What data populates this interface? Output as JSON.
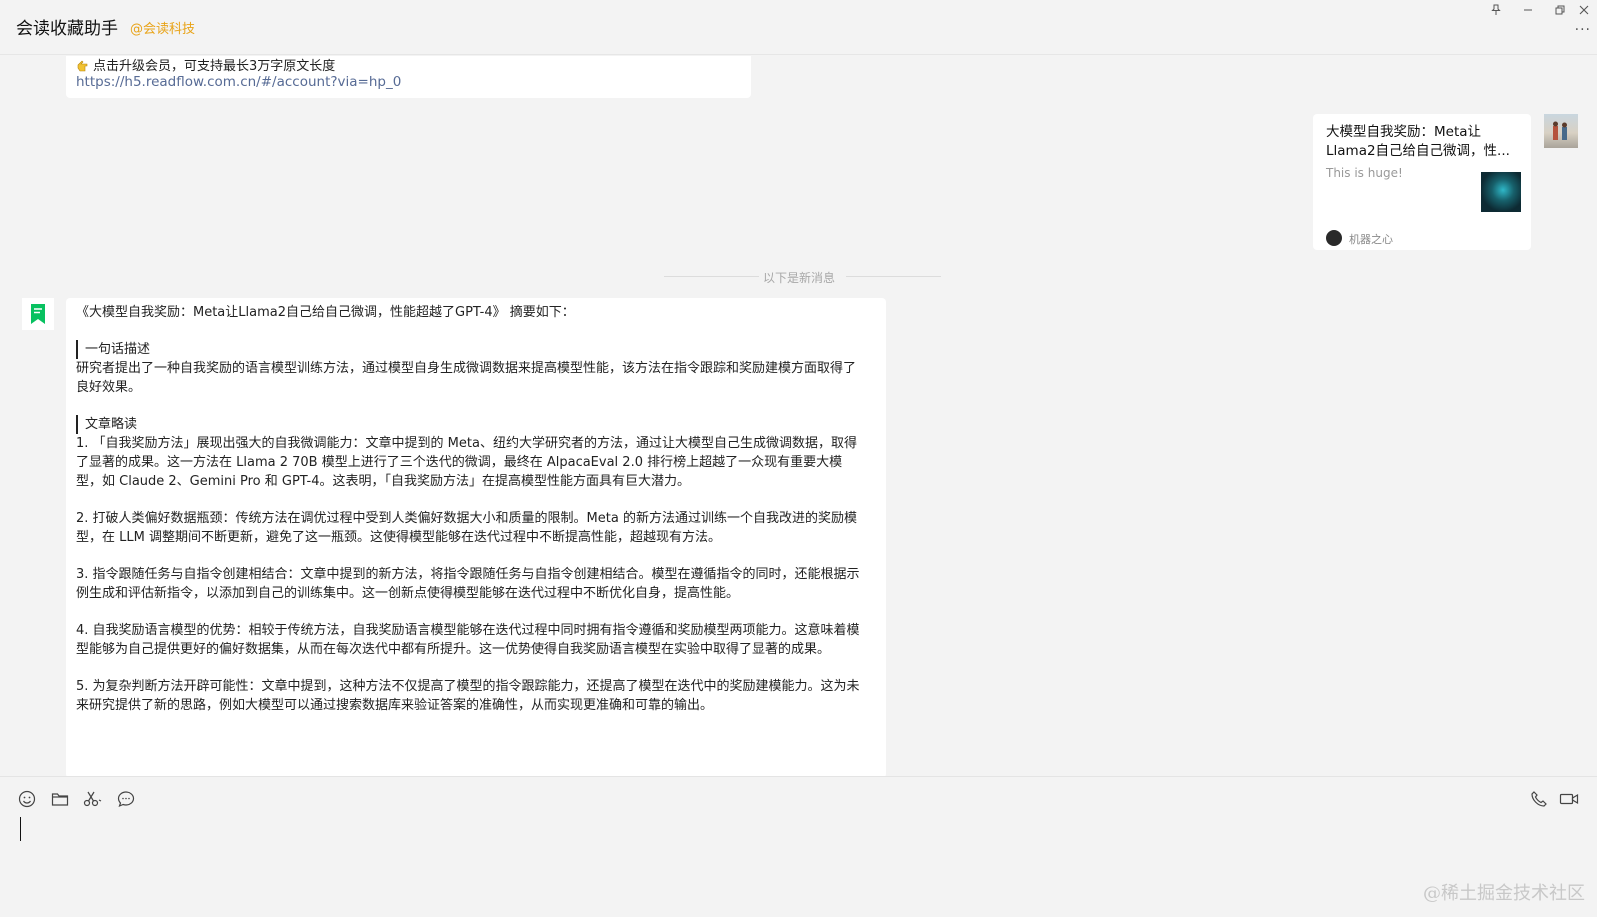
{
  "window": {
    "title": "会读收藏助手",
    "org_tag": "@会读科技"
  },
  "previous_message": {
    "line1": "点击升级会员，可支持最长3万字原文长度",
    "link": "https://h5.readflow.com.cn/#/account?via=hp_0"
  },
  "shared_card": {
    "title": "大模型自我奖励：Meta让Llama2自己给自己微调，性...",
    "description": "This is huge!",
    "source": "机器之心"
  },
  "divider_text": "以下是新消息",
  "summary": {
    "intro": "《大模型自我奖励：Meta让Llama2自己给自己微调，性能超越了GPT-4》 摘要如下：",
    "section1_head": "一句话描述",
    "section1_body": "研究者提出了一种自我奖励的语言模型训练方法，通过模型自身生成微调数据来提高模型性能，该方法在指令跟踪和奖励建模方面取得了良好效果。",
    "section2_head": "文章略读",
    "points": [
      "1. 「自我奖励方法」展现出强大的自我微调能力：文章中提到的 Meta、纽约大学研究者的方法，通过让大模型自己生成微调数据，取得了显著的成果。这一方法在 Llama 2 70B 模型上进行了三个迭代的微调，最终在 AlpacaEval 2.0 排行榜上超越了一众现有重要大模型，如 Claude 2、Gemini Pro 和 GPT-4。这表明，「自我奖励方法」在提高模型性能方面具有巨大潜力。",
      "2. 打破人类偏好数据瓶颈：传统方法在调优过程中受到人类偏好数据大小和质量的限制。Meta 的新方法通过训练一个自我改进的奖励模型，在 LLM 调整期间不断更新，避免了这一瓶颈。这使得模型能够在迭代过程中不断提高性能，超越现有方法。",
      "3. 指令跟随任务与自指令创建相结合：文章中提到的新方法，将指令跟随任务与自指令创建相结合。模型在遵循指令的同时，还能根据示例生成和评估新指令，以添加到自己的训练集中。这一创新点使得模型能够在迭代过程中不断优化自身，提高性能。",
      "4. 自我奖励语言模型的优势：相较于传统方法，自我奖励语言模型能够在迭代过程中同时拥有指令遵循和奖励模型两项能力。这意味着模型能够为自己提供更好的偏好数据集，从而在每次迭代中都有所提升。这一优势使得自我奖励语言模型在实验中取得了显著的成果。",
      "5. 为复杂判断方法开辟可能性：文章中提到，这种方法不仅提高了模型的指令跟踪能力，还提高了模型在迭代中的奖励建模能力。这为未来研究提供了新的思路，例如大模型可以通过搜索数据库来验证答案的准确性，从而实现更准确和可靠的输出。"
    ]
  },
  "watermark": "@稀土掘金技术社区",
  "icons": {
    "pin": "pin-icon",
    "minimize": "minimize-icon",
    "restore": "restore-icon",
    "close": "close-icon",
    "more": "more-icon",
    "emoji": "emoji-icon",
    "folder": "folder-icon",
    "scissors": "scissors-icon",
    "chat": "chat-bubble-icon",
    "phone": "phone-icon",
    "video": "video-icon",
    "bot_avatar": "bookmark-avatar-icon"
  },
  "colors": {
    "background": "#f3f3f3",
    "bubble": "#ffffff",
    "org_tag": "#e8a317",
    "link": "#576b95",
    "bot_green": "#07c160"
  }
}
